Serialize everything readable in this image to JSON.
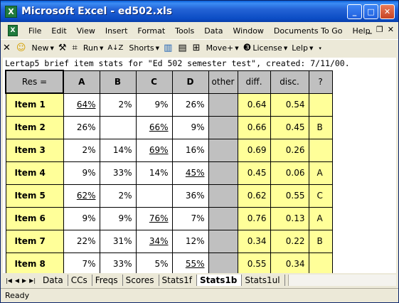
{
  "window": {
    "title": "Microsoft Excel - ed502.xls",
    "app_icon_glyph": "X"
  },
  "menu": {
    "items": [
      "File",
      "Edit",
      "View",
      "Insert",
      "Format",
      "Tools",
      "Data",
      "Window",
      "Documents To Go",
      "Help"
    ]
  },
  "toolbar": {
    "new_label": "New",
    "run_label": "Run",
    "shorts_label": "Shorts",
    "move_label": "Move+",
    "license_label": "License",
    "lelp_label": "Lelp"
  },
  "sheet": {
    "title_line": "Lertap5 brief item stats for \"Ed 502 semester test\", created: 7/11/00.",
    "headers": [
      "Res =",
      "A",
      "B",
      "C",
      "D",
      "other",
      "diff.",
      "disc.",
      "?"
    ],
    "rows": [
      {
        "item": "Item 1",
        "A": "64%",
        "B": "2%",
        "C": "9%",
        "D": "26%",
        "key": "A",
        "diff": "0.64",
        "disc": "0.54",
        "q": ""
      },
      {
        "item": "Item 2",
        "A": "26%",
        "B": "",
        "C": "66%",
        "D": "9%",
        "key": "C",
        "diff": "0.66",
        "disc": "0.45",
        "q": "B"
      },
      {
        "item": "Item 3",
        "A": "2%",
        "B": "14%",
        "C": "69%",
        "D": "16%",
        "key": "C",
        "diff": "0.69",
        "disc": "0.26",
        "q": ""
      },
      {
        "item": "Item 4",
        "A": "9%",
        "B": "33%",
        "C": "14%",
        "D": "45%",
        "key": "D",
        "diff": "0.45",
        "disc": "0.06",
        "q": "A"
      },
      {
        "item": "Item 5",
        "A": "62%",
        "B": "2%",
        "C": "",
        "D": "36%",
        "key": "A",
        "diff": "0.62",
        "disc": "0.55",
        "q": "C"
      },
      {
        "item": "Item 6",
        "A": "9%",
        "B": "9%",
        "C": "76%",
        "D": "7%",
        "key": "C",
        "diff": "0.76",
        "disc": "0.13",
        "q": "A"
      },
      {
        "item": "Item 7",
        "A": "22%",
        "B": "31%",
        "C": "34%",
        "D": "12%",
        "key": "C",
        "diff": "0.34",
        "disc": "0.22",
        "q": "B"
      },
      {
        "item": "Item 8",
        "A": "7%",
        "B": "33%",
        "C": "5%",
        "D": "55%",
        "key": "D",
        "diff": "0.55",
        "disc": "0.34",
        "q": ""
      }
    ]
  },
  "tabs": {
    "items": [
      "Data",
      "CCs",
      "Freqs",
      "Scores",
      "Stats1f",
      "Stats1b",
      "Stats1ul"
    ],
    "active": "Stats1b"
  },
  "status": {
    "text": "Ready"
  },
  "colors": {
    "yellow": "#ffff99",
    "gray": "#c0c0c0",
    "titlebar": "#0b4cc4"
  }
}
